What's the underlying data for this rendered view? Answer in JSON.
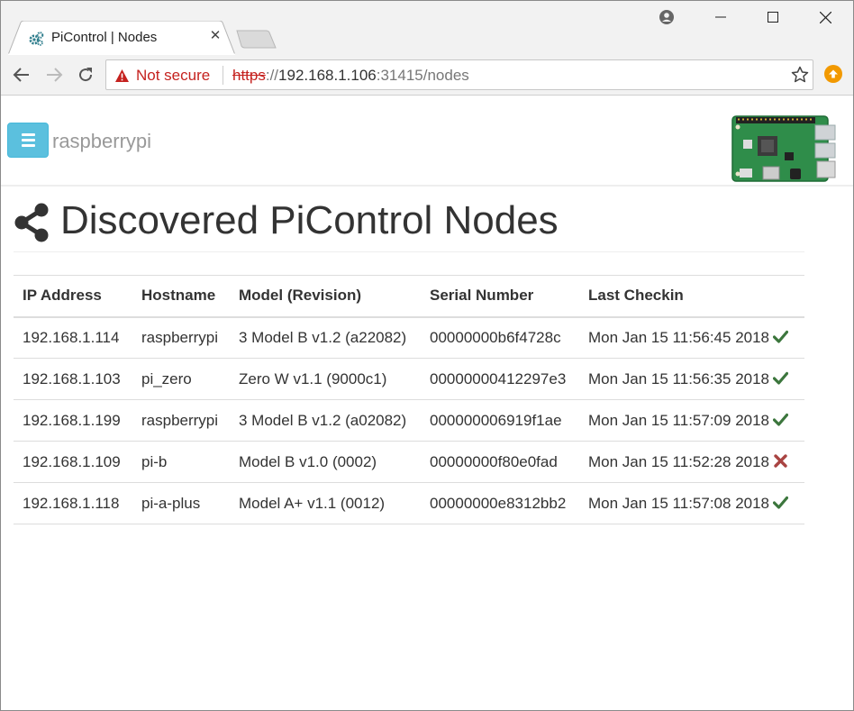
{
  "browser": {
    "tab_title": "PiControl | Nodes",
    "tab_close": "✕",
    "security_label": "Not secure",
    "url": {
      "scheme": "https",
      "separator": "://",
      "host": "192.168.1.106",
      "port_path": ":31415/nodes"
    },
    "colors": {
      "insecure": "#c5221f",
      "update": "#f29900"
    }
  },
  "navbar": {
    "brand": "raspberrypi",
    "toggle_color": "#5bc0de"
  },
  "page": {
    "title": "Discovered PiControl Nodes"
  },
  "table": {
    "headers": [
      "IP Address",
      "Hostname",
      "Model (Revision)",
      "Serial Number",
      "Last Checkin"
    ],
    "rows": [
      {
        "ip": "192.168.1.114",
        "hostname": "raspberrypi",
        "model": "3 Model B v1.2 (a22082)",
        "serial": "00000000b6f4728c",
        "checkin": "Mon Jan 15 11:56:45 2018",
        "status": "ok"
      },
      {
        "ip": "192.168.1.103",
        "hostname": "pi_zero",
        "model": "Zero W v1.1 (9000c1)",
        "serial": "00000000412297e3",
        "checkin": "Mon Jan 15 11:56:35 2018",
        "status": "ok"
      },
      {
        "ip": "192.168.1.199",
        "hostname": "raspberrypi",
        "model": "3 Model B v1.2 (a02082)",
        "serial": "000000006919f1ae",
        "checkin": "Mon Jan 15 11:57:09 2018",
        "status": "ok"
      },
      {
        "ip": "192.168.1.109",
        "hostname": "pi-b",
        "model": "Model B v1.0 (0002)",
        "serial": "00000000f80e0fad",
        "checkin": "Mon Jan 15 11:52:28 2018",
        "status": "error"
      },
      {
        "ip": "192.168.1.118",
        "hostname": "pi-a-plus",
        "model": "Model A+ v1.1 (0012)",
        "serial": "00000000e8312bb2",
        "checkin": "Mon Jan 15 11:57:08 2018",
        "status": "ok"
      }
    ],
    "status_colors": {
      "ok": "#3c763d",
      "error": "#a94442"
    }
  }
}
